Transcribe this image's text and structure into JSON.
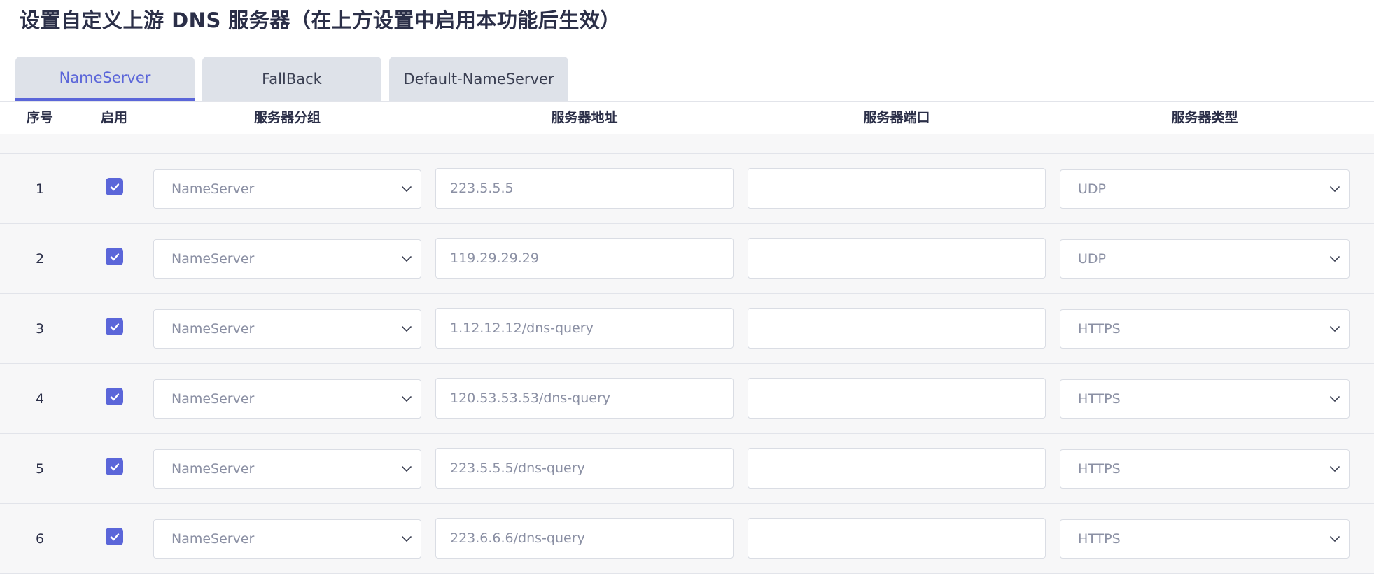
{
  "title": "设置自定义上游 DNS 服务器（在上方设置中启用本功能后生效）",
  "tabs": [
    {
      "label": "NameServer",
      "active": true
    },
    {
      "label": "FallBack",
      "active": false
    },
    {
      "label": "Default-NameServer",
      "active": false
    }
  ],
  "columns": {
    "index": "序号",
    "enabled": "启用",
    "group": "服务器分组",
    "address": "服务器地址",
    "port": "服务器端口",
    "type": "服务器类型"
  },
  "rows": [
    {
      "index": "1",
      "enabled": true,
      "group": "NameServer",
      "address": "223.5.5.5",
      "port": "",
      "type": "UDP"
    },
    {
      "index": "2",
      "enabled": true,
      "group": "NameServer",
      "address": "119.29.29.29",
      "port": "",
      "type": "UDP"
    },
    {
      "index": "3",
      "enabled": true,
      "group": "NameServer",
      "address": "1.12.12.12/dns-query",
      "port": "",
      "type": "HTTPS"
    },
    {
      "index": "4",
      "enabled": true,
      "group": "NameServer",
      "address": "120.53.53.53/dns-query",
      "port": "",
      "type": "HTTPS"
    },
    {
      "index": "5",
      "enabled": true,
      "group": "NameServer",
      "address": "223.5.5.5/dns-query",
      "port": "",
      "type": "HTTPS"
    },
    {
      "index": "6",
      "enabled": true,
      "group": "NameServer",
      "address": "223.6.6.6/dns-query",
      "port": "",
      "type": "HTTPS"
    }
  ],
  "colors": {
    "accent": "#5b66d9",
    "tab_bg": "#dee2e9",
    "row_bg": "#f7f7f8",
    "placeholder_text": "#8b90a4"
  },
  "icons": {
    "checkbox": "checkmark-icon",
    "dropdown": "chevron-down-icon"
  }
}
